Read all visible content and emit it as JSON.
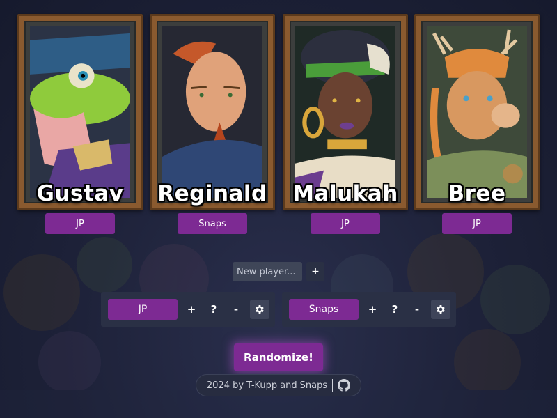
{
  "characters": [
    {
      "name": "Gustav",
      "player": "JP",
      "portrait_icon": "frog-wizard-portrait-icon"
    },
    {
      "name": "Reginald",
      "player": "Snaps",
      "portrait_icon": "bald-man-portrait-icon"
    },
    {
      "name": "Malukah",
      "player": "JP",
      "portrait_icon": "skull-headdress-woman-portrait-icon"
    },
    {
      "name": "Bree",
      "player": "JP",
      "portrait_icon": "deer-archer-portrait-icon"
    }
  ],
  "add_player": {
    "placeholder": "New player...",
    "add_label": "+"
  },
  "players": [
    {
      "name": "JP",
      "plus": "+",
      "question": "?",
      "minus": "-"
    },
    {
      "name": "Snaps",
      "plus": "+",
      "question": "?",
      "minus": "-"
    }
  ],
  "randomize_label": "Randomize!",
  "footer": {
    "year_text": "2024 by",
    "author1": "T-Kupp",
    "and_text": "and",
    "author2": "Snaps",
    "github_icon": "github-icon"
  },
  "colors": {
    "accent": "#7d2a93",
    "background": "#1d2138",
    "panel": "#2a3045"
  }
}
